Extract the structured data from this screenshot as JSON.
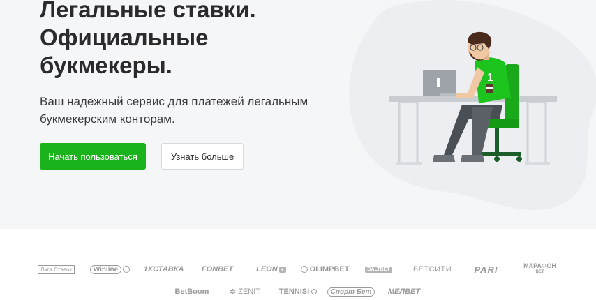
{
  "hero": {
    "headline": [
      "Легальные ставки.",
      "Официальные",
      "букмекеры."
    ],
    "subtitle": [
      "Ваш надежный сервис для платежей легальным",
      "букмекерским конторам."
    ],
    "primary_button": "Начать пользоваться",
    "secondary_button": "Узнать больше",
    "colors": {
      "accent": "#1bb31b",
      "background": "#f5f6f8",
      "text": "#2b2b2b"
    }
  },
  "illustration": {
    "jersey_number": "1"
  },
  "partners": {
    "row1": [
      {
        "name": "liga-stavok",
        "text": "Лига Ставок"
      },
      {
        "name": "winline",
        "text": "Winline"
      },
      {
        "name": "1xstavka",
        "text": "1XСТАВКА"
      },
      {
        "name": "fonbet",
        "text": "FONBET"
      },
      {
        "name": "leon",
        "text": "LEON"
      },
      {
        "name": "olimpbet",
        "text": "OLIMPBET"
      },
      {
        "name": "baltbet",
        "text": "BALTBET"
      },
      {
        "name": "betcity",
        "text": "БЕТСИТИ"
      },
      {
        "name": "pari",
        "text": "PARI"
      },
      {
        "name": "marathon",
        "text": "МАРАФОН",
        "sub": "BET"
      }
    ],
    "row2": [
      {
        "name": "betboom",
        "text": "BetBoom"
      },
      {
        "name": "zenit",
        "text": "ZENIT"
      },
      {
        "name": "tennisi",
        "text": "TENNISI"
      },
      {
        "name": "sportbet",
        "text": "Спорт Бет"
      },
      {
        "name": "melbet",
        "text": "МЕЛBET"
      }
    ]
  }
}
